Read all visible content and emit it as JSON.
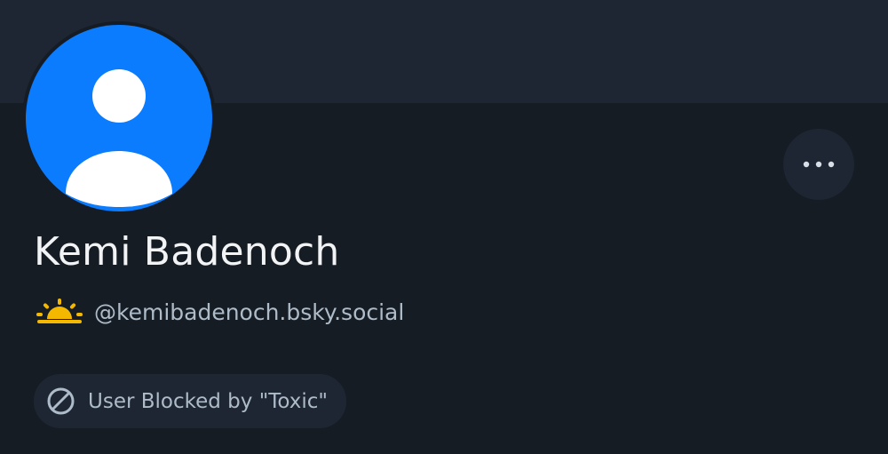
{
  "colors": {
    "background": "#161c24",
    "banner": "#1e2633",
    "avatar_blue": "#0c7cff",
    "text_primary": "#f1f3f5",
    "text_secondary": "#aebbc9",
    "sunrise_yellow": "#f5b800"
  },
  "profile": {
    "display_name": "Kemi Badenoch",
    "handle_emoji": "sunrise-icon",
    "handle": "@kemibadenoch.bsky.social",
    "avatar_icon": "default-user-avatar-icon"
  },
  "actions": {
    "more_icon": "ellipsis-icon"
  },
  "moderation": {
    "icon": "blocked-circle-icon",
    "label": "User Blocked by \"Toxic\""
  }
}
